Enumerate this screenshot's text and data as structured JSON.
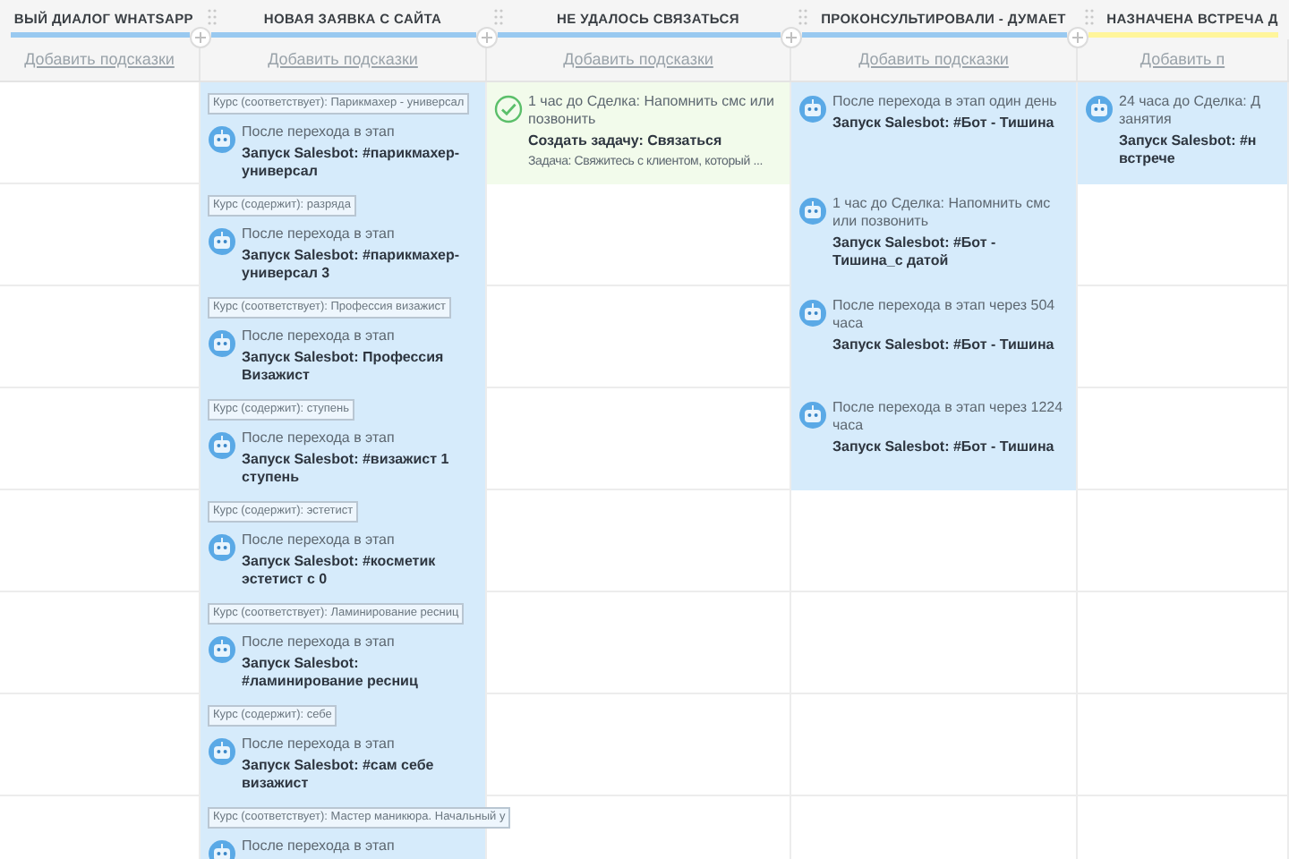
{
  "columns": [
    {
      "title": "ВЫЙ ДИАЛОГ WHATSAPP",
      "color": "#99c9f0",
      "hint": "Добавить подсказки"
    },
    {
      "title": "НОВАЯ ЗАЯВКА С САЙТА",
      "color": "#99c9f0",
      "hint": "Добавить подсказки"
    },
    {
      "title": "НЕ УДАЛОСЬ СВЯЗАТЬСЯ",
      "color": "#99c9f0",
      "hint": "Добавить подсказки"
    },
    {
      "title": "ПРОКОНСУЛЬТИРОВАЛИ - ДУМАЕТ",
      "color": "#99c9f0",
      "hint": "Добавить подсказки"
    },
    {
      "title": "НАЗНАЧЕНА ВСТРЕЧА Д",
      "color": "#fff59b",
      "hint": "Добавить п"
    }
  ],
  "rows": [
    {
      "cells": [
        null,
        {
          "kind": "bot",
          "tag": "Курс (соответствует): Парикмахер - универсал",
          "trigger": "После перехода в этап",
          "action": "Запуск Salesbot: #парикмахер-универсал"
        },
        {
          "kind": "task",
          "trigger": "1 час до Сделка: Напомнить смс или позвонить",
          "action": "Создать задачу: Связаться",
          "detail": "Задача: Свяжитесь с клиентом, который ..."
        },
        {
          "kind": "bot",
          "trigger": "После перехода в этап один день",
          "action": "Запуск Salesbot: #Бот - Тишина"
        },
        {
          "kind": "bot",
          "trigger": "24 часа до Сделка: Д\nзанятия",
          "action": "Запуск Salesbot: #н\nвстрече"
        }
      ]
    },
    {
      "cells": [
        null,
        {
          "kind": "bot",
          "tag": "Курс (содержит): разряда",
          "trigger": "После перехода в этап",
          "action": "Запуск Salesbot: #парикмахер-универсал 3"
        },
        null,
        {
          "kind": "bot",
          "trigger": "1 час до Сделка: Напомнить смс или позвонить",
          "action": "Запуск Salesbot: #Бот - Тишина_с датой"
        },
        null
      ]
    },
    {
      "cells": [
        null,
        {
          "kind": "bot",
          "tag": "Курс (соответствует): Профессия визажист",
          "trigger": "После перехода в этап",
          "action": "Запуск Salesbot: Профессия Визажист"
        },
        null,
        {
          "kind": "bot",
          "trigger": "После перехода в этап через 504 часа",
          "action": "Запуск Salesbot: #Бот - Тишина"
        },
        null
      ]
    },
    {
      "cells": [
        null,
        {
          "kind": "bot",
          "tag": "Курс (содержит): ступень",
          "trigger": "После перехода в этап",
          "action": "Запуск Salesbot: #визажист 1 ступень"
        },
        null,
        {
          "kind": "bot",
          "trigger": "После перехода в этап через 1224 часа",
          "action": "Запуск Salesbot: #Бот - Тишина"
        },
        null
      ]
    },
    {
      "cells": [
        null,
        {
          "kind": "bot",
          "tag": "Курс (содержит): эстетист",
          "trigger": "После перехода в этап",
          "action": "Запуск Salesbot: #косметик эстетист с 0"
        },
        null,
        null,
        null
      ]
    },
    {
      "cells": [
        null,
        {
          "kind": "bot",
          "tag": "Курс (соответствует): Ламинирование ресниц",
          "trigger": "После перехода в этап",
          "action": "Запуск Salesbot: #ламинирование ресниц"
        },
        null,
        null,
        null
      ]
    },
    {
      "cells": [
        null,
        {
          "kind": "bot",
          "tag": "Курс (содержит): себе",
          "trigger": "После перехода в этап",
          "action": "Запуск Salesbot: #сам себе визажист"
        },
        null,
        null,
        null
      ]
    },
    {
      "cells": [
        null,
        {
          "kind": "bot",
          "tag": "Курс (соответствует): Мастер маникюра. Начальный у",
          "trigger": "После перехода в этап"
        },
        null,
        null,
        null
      ]
    }
  ]
}
